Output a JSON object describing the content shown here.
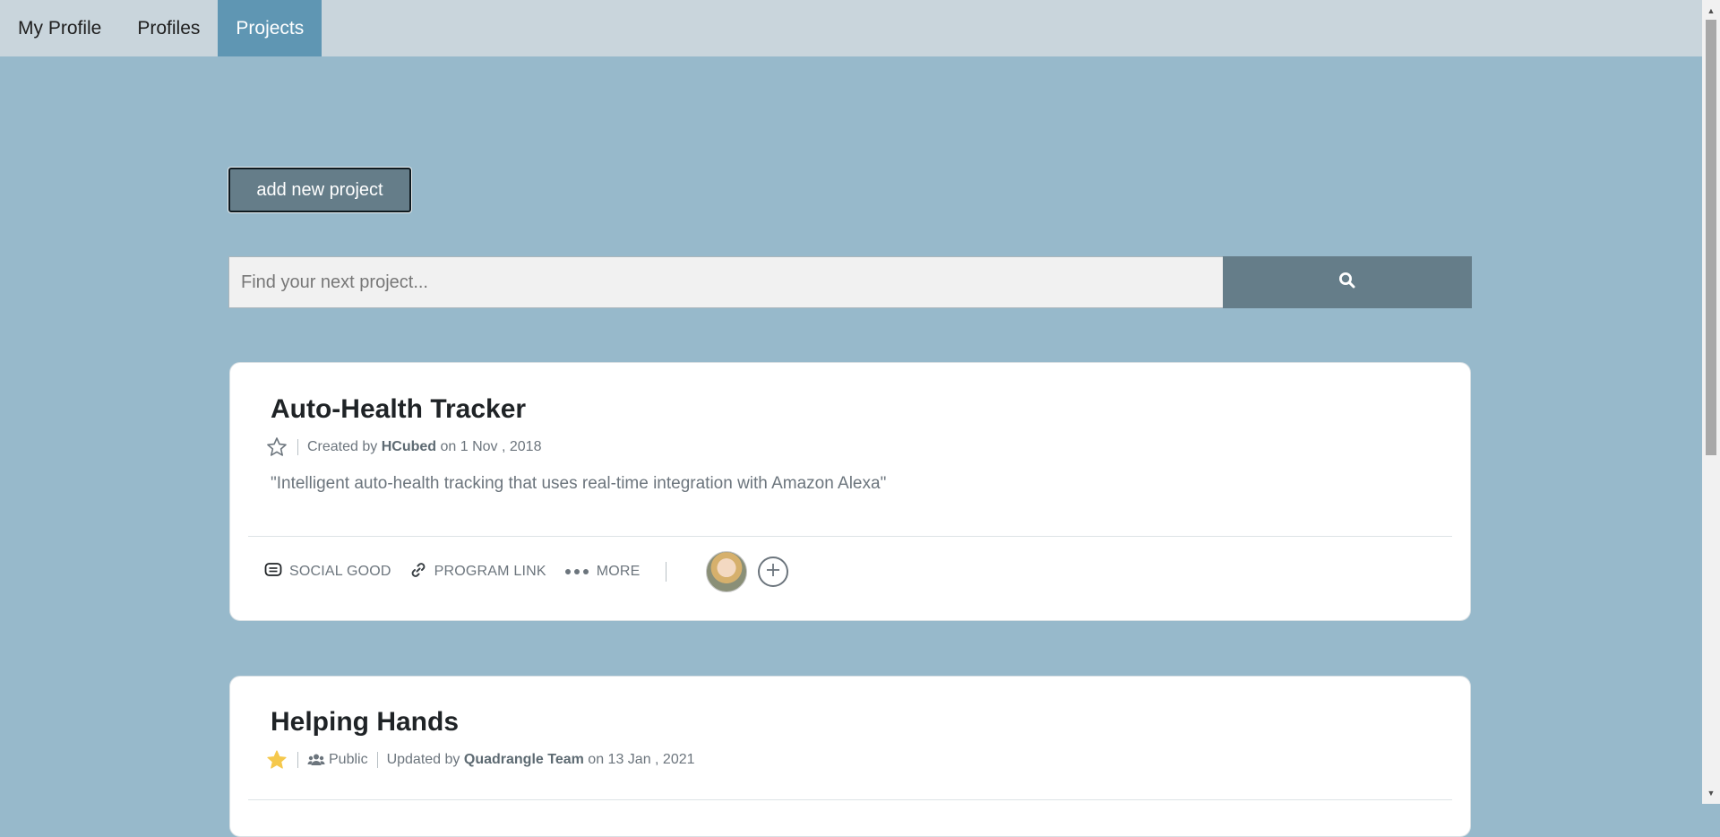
{
  "nav": {
    "items": [
      {
        "label": "My Profile"
      },
      {
        "label": "Profiles"
      },
      {
        "label": "Projects"
      }
    ],
    "active_index": 2
  },
  "add_project_label": "add new project",
  "search": {
    "placeholder": "Find your next project...",
    "button_icon": "search-icon"
  },
  "projects": [
    {
      "title": "Auto-Health Tracker",
      "starred": false,
      "created_prefix": "Created by",
      "author": "HCubed",
      "date_prefix": "on",
      "date": "1 Nov , 2018",
      "description": "\"Intelligent auto-health tracking that uses real-time integration with Amazon Alexa\"",
      "tag": "SOCIAL GOOD",
      "link_label": "PROGRAM LINK",
      "more_label": "MORE"
    },
    {
      "title": "Helping Hands",
      "starred": true,
      "visibility": "Public",
      "updated_prefix": "Updated by",
      "author": "Quadrangle Team",
      "date_prefix": "on",
      "date": "13 Jan , 2021"
    }
  ],
  "colors": {
    "background": "#97b9cb",
    "nav_bg": "#c9d5dc",
    "nav_active": "#5f96b3",
    "button": "#657d89",
    "star_active": "#f5c84c"
  }
}
